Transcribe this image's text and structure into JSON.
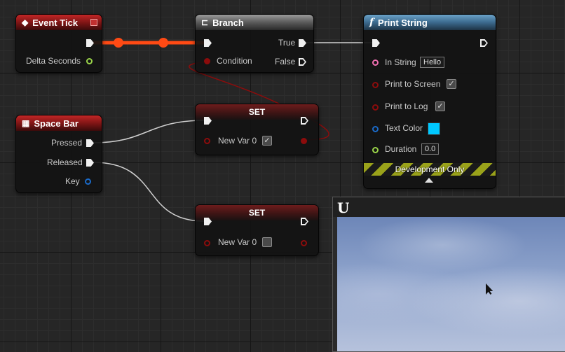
{
  "nodes": {
    "event_tick": {
      "title": "Event Tick",
      "icon": "event-diamond-icon",
      "pins": {
        "delta_seconds": "Delta Seconds"
      }
    },
    "branch": {
      "title": "Branch",
      "icon": "branch-icon",
      "pins": {
        "true": "True",
        "condition": "Condition",
        "false": "False"
      }
    },
    "print_string": {
      "title": "Print String",
      "icon": "function-icon",
      "icon_text": "f",
      "pins": {
        "in_string": "In String",
        "in_string_value": "Hello",
        "print_to_screen": "Print to Screen",
        "print_to_log": "Print to Log",
        "text_color": "Text Color",
        "duration": "Duration",
        "duration_value": "0.0"
      },
      "footer": "Development Only",
      "text_color_value": "#00c8ff",
      "print_to_screen_checked": true,
      "print_to_log_checked": true
    },
    "space_bar": {
      "title": "Space Bar",
      "icon": "keyboard-icon",
      "pins": {
        "pressed": "Pressed",
        "released": "Released",
        "key": "Key"
      }
    },
    "set_1": {
      "title": "SET",
      "pins": {
        "var": "New Var 0"
      },
      "checked": true
    },
    "set_2": {
      "title": "SET",
      "pins": {
        "var": "New Var 0"
      },
      "checked": false
    }
  },
  "viewport": {
    "logo": "U"
  },
  "colors": {
    "exec_wire_active": "#ff4a14",
    "exec_wire": "#d0d0d0",
    "bool_pin": "#8c0c0c",
    "string_pin": "#f06fb0",
    "float_pin": "#9ad44a",
    "struct_pin": "#1a6ac8"
  }
}
